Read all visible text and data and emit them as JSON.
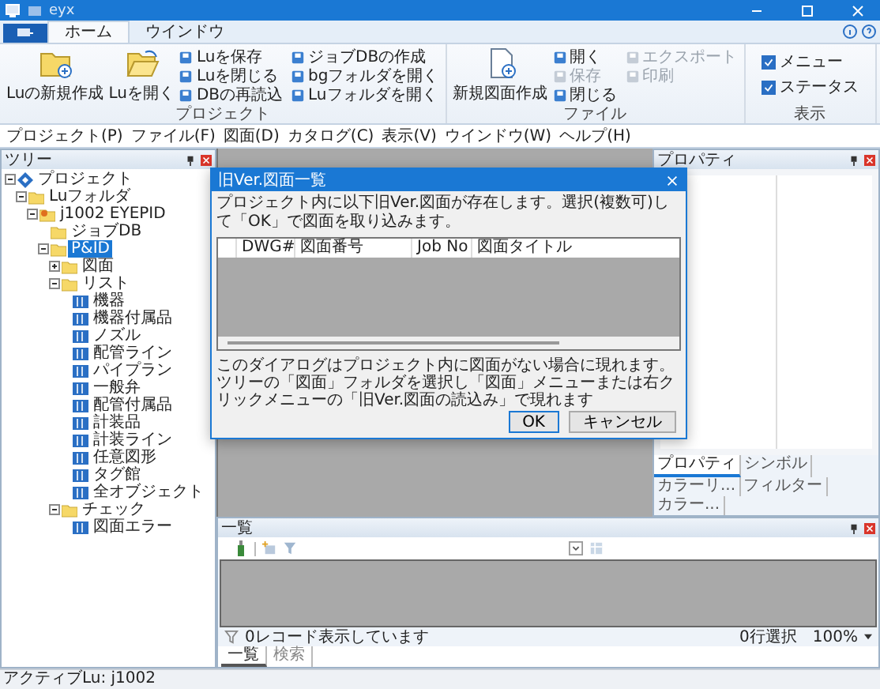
{
  "window": {
    "title": "eyx"
  },
  "ribbon_tabs": [
    {
      "label": "ホーム",
      "selected": true
    },
    {
      "label": "ウインドウ",
      "selected": false
    }
  ],
  "ribbon_groups": [
    {
      "label": "プロジェクト",
      "kind": "buttons",
      "large": [
        "Luの新規作成",
        "Luを開く"
      ],
      "small": [
        {
          "label": "Luを保存",
          "disabled": false
        },
        {
          "label": "Luを閉じる",
          "disabled": false
        },
        {
          "label": "DBの再読込",
          "disabled": false
        },
        {
          "label": "ジョブDBの作成",
          "disabled": false
        },
        {
          "label": "bgフォルダを開く",
          "disabled": false
        },
        {
          "label": "Luフォルダを開く",
          "disabled": false
        }
      ]
    },
    {
      "label": "ファイル",
      "kind": "buttons",
      "large": [
        "新規図面作成"
      ],
      "small": [
        {
          "label": "開く",
          "disabled": false
        },
        {
          "label": "保存",
          "disabled": true
        },
        {
          "label": "閉じる",
          "disabled": false
        },
        {
          "label": "エクスポート",
          "disabled": true
        },
        {
          "label": "印刷",
          "disabled": true
        }
      ]
    },
    {
      "label": "表示",
      "kind": "checks",
      "checks": [
        {
          "label": "メニュー",
          "checked": true
        },
        {
          "label": "ステータス",
          "checked": true
        }
      ]
    }
  ],
  "menu": [
    "プロジェクト(P)",
    "ファイル(F)",
    "図面(D)",
    "カタログ(C)",
    "表示(V)",
    "ウインドウ(W)",
    "ヘルプ(H)"
  ],
  "tree": {
    "title": "ツリー",
    "items": [
      {
        "label": "プロジェクト",
        "kind": "project",
        "expanded": true,
        "selected": false,
        "children": [
          {
            "label": "Luフォルダ",
            "kind": "folder",
            "expanded": true,
            "selected": false,
            "children": [
              {
                "label": "j1002 EYEPID",
                "kind": "job",
                "expanded": true,
                "selected": false,
                "children": [
                  {
                    "label": "ジョブDB",
                    "kind": "folder",
                    "selected": false
                  },
                  {
                    "label": "P&ID",
                    "kind": "folder",
                    "expanded": true,
                    "selected": true,
                    "children": [
                      {
                        "label": "図面",
                        "kind": "folder",
                        "expanded": false,
                        "selected": false
                      },
                      {
                        "label": "リスト",
                        "kind": "folder",
                        "expanded": true,
                        "selected": false,
                        "children": [
                          {
                            "label": "機器",
                            "kind": "list",
                            "selected": false
                          },
                          {
                            "label": "機器付属品",
                            "kind": "list",
                            "selected": false
                          },
                          {
                            "label": "ノズル",
                            "kind": "list",
                            "selected": false
                          },
                          {
                            "label": "配管ライン",
                            "kind": "list",
                            "selected": false
                          },
                          {
                            "label": "パイプラン",
                            "kind": "list",
                            "selected": false
                          },
                          {
                            "label": "一般弁",
                            "kind": "list",
                            "selected": false
                          },
                          {
                            "label": "配管付属品",
                            "kind": "list",
                            "selected": false
                          },
                          {
                            "label": "計装品",
                            "kind": "list",
                            "selected": false
                          },
                          {
                            "label": "計装ライン",
                            "kind": "list",
                            "selected": false
                          },
                          {
                            "label": "任意図形",
                            "kind": "list",
                            "selected": false
                          },
                          {
                            "label": "タグ館",
                            "kind": "list",
                            "selected": false
                          },
                          {
                            "label": "全オブジェクト",
                            "kind": "list",
                            "selected": false
                          }
                        ]
                      },
                      {
                        "label": "チェック",
                        "kind": "folder",
                        "expanded": true,
                        "selected": false,
                        "children": [
                          {
                            "label": "図面エラー",
                            "kind": "list",
                            "selected": false
                          }
                        ]
                      }
                    ]
                  }
                ]
              }
            ]
          }
        ]
      }
    ]
  },
  "properties": {
    "title": "プロパティ",
    "tabs": [
      {
        "label": "プロパティ",
        "selected": true
      },
      {
        "label": "シンボル",
        "selected": false
      },
      {
        "label": "カラーリ...",
        "selected": false
      },
      {
        "label": "フィルター",
        "selected": false
      },
      {
        "label": "カラー...",
        "selected": false
      }
    ]
  },
  "list_panel": {
    "title": "一覧",
    "status": "0レコード表示しています",
    "selection": "0行選択",
    "zoom": "100%",
    "tabs": [
      {
        "label": "一覧",
        "selected": true
      },
      {
        "label": "検索",
        "selected": false
      }
    ]
  },
  "dialog": {
    "title": "旧Ver.図面一覧",
    "message": "プロジェクト内に以下旧Ver.図面が存在します。選択(複数可)して「OK」で図面を取り込みます。",
    "columns": [
      "DWG#",
      "図面番号",
      "Job No",
      "図面タイトル"
    ],
    "note": "このダイアログはプロジェクト内に図面がない場合に現れます。ツリーの「図面」フォルダを選択し「図面」メニューまたは右クリックメニューの「旧Ver.図面の読込み」で現れます",
    "buttons": [
      {
        "label": "OK",
        "default": true
      },
      {
        "label": "キャンセル",
        "default": false
      }
    ]
  },
  "status_bar": "アクティブLu: j1002"
}
